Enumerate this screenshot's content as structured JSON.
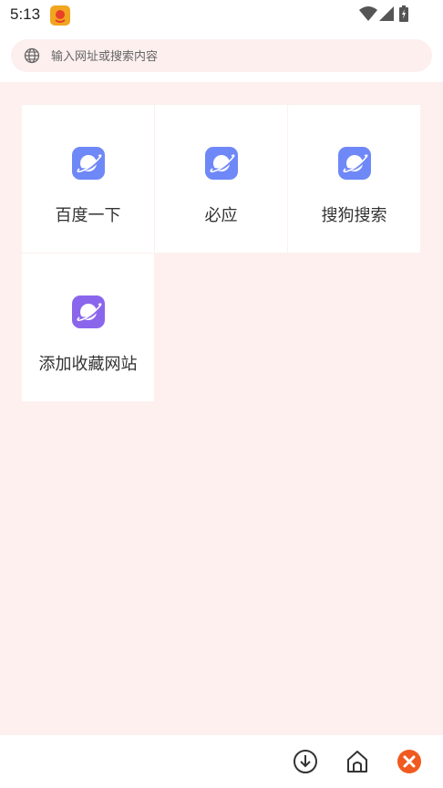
{
  "status_bar": {
    "time": "5:13",
    "notification_icon": "app-notification-icon",
    "icons": [
      "wifi-icon",
      "signal-icon",
      "battery-icon"
    ]
  },
  "search": {
    "placeholder": "输入网址或搜索内容",
    "icon": "globe-icon"
  },
  "shortcuts": [
    {
      "label": "百度一下",
      "icon": "planet-icon",
      "color": "#6f88f7"
    },
    {
      "label": "必应",
      "icon": "planet-icon",
      "color": "#6f88f7"
    },
    {
      "label": "搜狗搜索",
      "icon": "planet-icon",
      "color": "#6f88f7"
    },
    {
      "label": "添加收藏网站",
      "icon": "planet-icon",
      "color": "#8a66ec"
    }
  ],
  "bottom_bar": {
    "buttons": [
      "download-icon",
      "home-icon",
      "close-icon"
    ],
    "close_color": "#f05a1e"
  },
  "colors": {
    "background": "#fdf0ef",
    "search_bar": "#fcefee"
  }
}
